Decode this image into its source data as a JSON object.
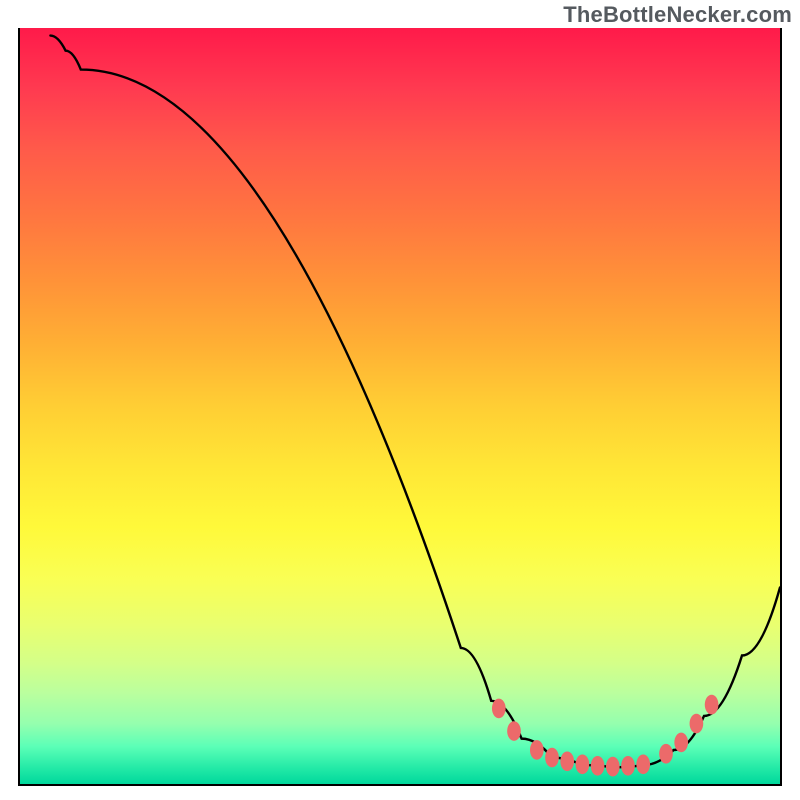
{
  "watermark": "TheBottleNecker.com",
  "chart_data": {
    "type": "line",
    "title": "",
    "xlabel": "",
    "ylabel": "",
    "xlim": [
      0,
      100
    ],
    "ylim": [
      0,
      100
    ],
    "curve": [
      {
        "x": 4,
        "y": 99
      },
      {
        "x": 6,
        "y": 97
      },
      {
        "x": 8,
        "y": 94.5
      },
      {
        "x": 58,
        "y": 18
      },
      {
        "x": 62,
        "y": 11
      },
      {
        "x": 66,
        "y": 6
      },
      {
        "x": 70,
        "y": 3.5
      },
      {
        "x": 74,
        "y": 2.5
      },
      {
        "x": 78,
        "y": 2.2
      },
      {
        "x": 82,
        "y": 2.5
      },
      {
        "x": 86,
        "y": 4.5
      },
      {
        "x": 90,
        "y": 9
      },
      {
        "x": 95,
        "y": 17
      },
      {
        "x": 100,
        "y": 26
      }
    ],
    "markers": [
      {
        "x": 63,
        "y": 10
      },
      {
        "x": 65,
        "y": 7
      },
      {
        "x": 68,
        "y": 4.5
      },
      {
        "x": 70,
        "y": 3.5
      },
      {
        "x": 72,
        "y": 3
      },
      {
        "x": 74,
        "y": 2.6
      },
      {
        "x": 76,
        "y": 2.4
      },
      {
        "x": 78,
        "y": 2.3
      },
      {
        "x": 80,
        "y": 2.4
      },
      {
        "x": 82,
        "y": 2.6
      },
      {
        "x": 85,
        "y": 4
      },
      {
        "x": 87,
        "y": 5.5
      },
      {
        "x": 89,
        "y": 8
      },
      {
        "x": 91,
        "y": 10.5
      }
    ],
    "marker_color": "#ec6a6a",
    "curve_color": "#000000",
    "curve_width": 2
  }
}
